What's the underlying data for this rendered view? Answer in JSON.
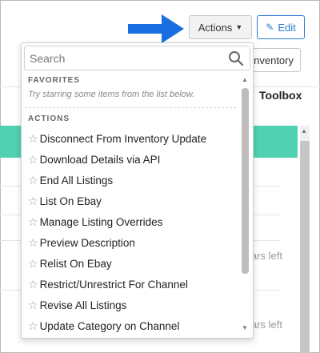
{
  "header": {
    "actions_label": "Actions",
    "edit_label": "Edit",
    "inventory_label": "Inventory"
  },
  "background": {
    "toolbox_label": "Toolbox",
    "rows": [
      {
        "text": "ars left"
      },
      {
        "text": "ars left"
      }
    ]
  },
  "dropdown": {
    "search": {
      "placeholder": "Search",
      "value": ""
    },
    "favorites": {
      "header": "FAVORITES",
      "hint": "Try starring some items from the list below."
    },
    "actions": {
      "header": "ACTIONS",
      "items": [
        {
          "label": "Disconnect From Inventory Update"
        },
        {
          "label": "Download Details via API"
        },
        {
          "label": "End All Listings"
        },
        {
          "label": "List On Ebay"
        },
        {
          "label": "Manage Listing Overrides"
        },
        {
          "label": "Preview Description"
        },
        {
          "label": "Relist On Ebay"
        },
        {
          "label": "Restrict/Unrestrict For Channel"
        },
        {
          "label": "Revise All Listings"
        },
        {
          "label": "Update Category on Channel"
        }
      ]
    }
  },
  "icons": {
    "star": "star-outline-icon",
    "search": "search-icon",
    "edit": "pencil-icon",
    "caret": "caret-down-icon",
    "arrow": "arrow-right-icon"
  },
  "colors": {
    "arrow": "#1a6fe0",
    "edit_border": "#2b7bd3",
    "teal_row": "#4fd1b2"
  }
}
